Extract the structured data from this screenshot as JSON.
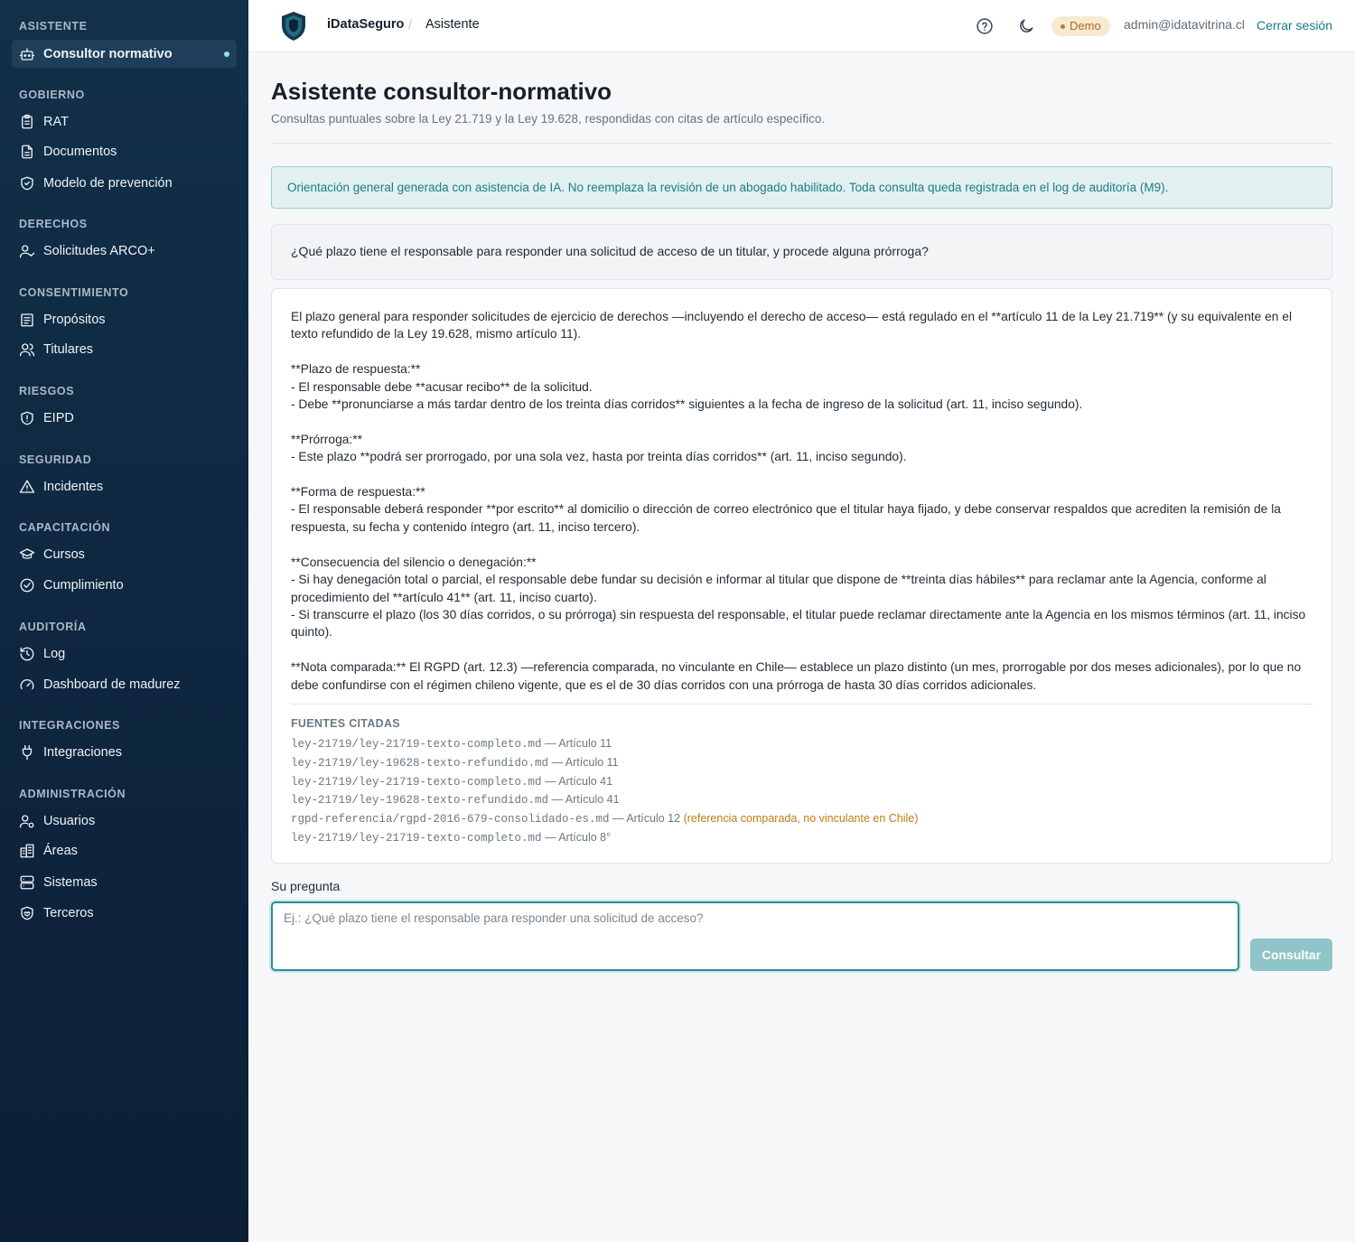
{
  "sidebar": {
    "sections": [
      {
        "title": "ASISTENTE",
        "items": [
          {
            "label": "Consultor normativo",
            "icon": "robot-icon",
            "active": true
          }
        ]
      },
      {
        "title": "GOBIERNO",
        "items": [
          {
            "label": "RAT",
            "icon": "clipboard-icon"
          },
          {
            "label": "Documentos",
            "icon": "document-icon"
          },
          {
            "label": "Modelo de prevención",
            "icon": "shield-check-icon"
          }
        ]
      },
      {
        "title": "DERECHOS",
        "items": [
          {
            "label": "Solicitudes ARCO+",
            "icon": "user-check-icon"
          }
        ]
      },
      {
        "title": "CONSENTIMIENTO",
        "items": [
          {
            "label": "Propósitos",
            "icon": "list-icon"
          },
          {
            "label": "Titulares",
            "icon": "users-icon"
          }
        ]
      },
      {
        "title": "RIESGOS",
        "items": [
          {
            "label": "EIPD",
            "icon": "shield-alert-icon"
          }
        ]
      },
      {
        "title": "SEGURIDAD",
        "items": [
          {
            "label": "Incidentes",
            "icon": "warning-icon"
          }
        ]
      },
      {
        "title": "CAPACITACIÓN",
        "items": [
          {
            "label": "Cursos",
            "icon": "graduation-cap-icon"
          },
          {
            "label": "Cumplimiento",
            "icon": "check-circle-icon"
          }
        ]
      },
      {
        "title": "AUDITORÍA",
        "items": [
          {
            "label": "Log",
            "icon": "history-icon"
          },
          {
            "label": "Dashboard de madurez",
            "icon": "gauge-icon"
          }
        ]
      },
      {
        "title": "INTEGRACIONES",
        "items": [
          {
            "label": "Integraciones",
            "icon": "plug-icon"
          }
        ]
      },
      {
        "title": "ADMINISTRACIÓN",
        "items": [
          {
            "label": "Usuarios",
            "icon": "user-gear-icon"
          },
          {
            "label": "Áreas",
            "icon": "building-icon"
          },
          {
            "label": "Sistemas",
            "icon": "server-icon"
          },
          {
            "label": "Terceros",
            "icon": "handshake-icon"
          }
        ]
      }
    ]
  },
  "header": {
    "brand": "iDataSeguro",
    "separator": "/",
    "breadcrumb": "Asistente",
    "badge": "Demo",
    "user_email": "admin@idatavitrina.cl",
    "logout": "Cerrar sesión"
  },
  "main": {
    "title": "Asistente consultor-normativo",
    "subtitle": "Consultas puntuales sobre la Ley 21.719 y la Ley 19.628, respondidas con citas de artículo específico.",
    "notice": "Orientación general generada con asistencia de IA. No reemplaza la revisión de un abogado habilitado. Toda consulta queda registrada en el log de auditoría (M9).",
    "question": "¿Qué plazo tiene el responsable para responder una solicitud de acceso de un titular, y procede alguna prórroga?",
    "answer": "El plazo general para responder solicitudes de ejercicio de derechos —incluyendo el derecho de acceso— está regulado en el **artículo 11 de la Ley 21.719** (y su equivalente en el texto refundido de la Ley 19.628, mismo artículo 11).\n\n**Plazo de respuesta:**\n- El responsable debe **acusar recibo** de la solicitud.\n- Debe **pronunciarse a más tardar dentro de los treinta días corridos** siguientes a la fecha de ingreso de la solicitud (art. 11, inciso segundo).\n\n**Prórroga:**\n- Este plazo **podrá ser prorrogado, por una sola vez, hasta por treinta días corridos** (art. 11, inciso segundo).\n\n**Forma de respuesta:**\n- El responsable deberá responder **por escrito** al domicilio o dirección de correo electrónico que el titular haya fijado, y debe conservar respaldos que acrediten la remisión de la respuesta, su fecha y contenido íntegro (art. 11, inciso tercero).\n\n**Consecuencia del silencio o denegación:**\n- Si hay denegación total o parcial, el responsable debe fundar su decisión e informar al titular que dispone de **treinta días hábiles** para reclamar ante la Agencia, conforme al procedimiento del **artículo 41** (art. 11, inciso cuarto).\n- Si transcurre el plazo (los 30 días corridos, o su prórroga) sin respuesta del responsable, el titular puede reclamar directamente ante la Agencia en los mismos términos (art. 11, inciso quinto).\n\n**Nota comparada:** El RGPD (art. 12.3) —referencia comparada, no vinculante en Chile— establece un plazo distinto (un mes, prorrogable por dos meses adicionales), por lo que no debe confundirse con el régimen chileno vigente, que es el de 30 días corridos con una prórroga de hasta 30 días corridos adicionales.",
    "sources_title": "FUENTES CITADAS",
    "sources": [
      {
        "file": "ley-21719/ley-21719-texto-completo.md",
        "ref": " — Artículo 11",
        "note": ""
      },
      {
        "file": "ley-21719/ley-19628-texto-refundido.md",
        "ref": " — Artículo 11",
        "note": ""
      },
      {
        "file": "ley-21719/ley-21719-texto-completo.md",
        "ref": " — Artículo 41",
        "note": ""
      },
      {
        "file": "ley-21719/ley-19628-texto-refundido.md",
        "ref": " — Artículo 41",
        "note": ""
      },
      {
        "file": "rgpd-referencia/rgpd-2016-679-consolidado-es.md",
        "ref": " — Artículo 12",
        "note": "(referencia comparada, no vinculante en Chile)"
      },
      {
        "file": "ley-21719/ley-21719-texto-completo.md",
        "ref": " — Artículo 8°",
        "note": ""
      }
    ],
    "input_label": "Su pregunta",
    "input_placeholder": "Ej.: ¿Qué plazo tiene el responsable para responder una solicitud de acceso?",
    "input_value": "",
    "submit_label": "Consultar"
  },
  "colors": {
    "sidebar_bg": "#0f2740",
    "accent": "#157b86",
    "notice_bg": "#e2f0f1",
    "badge_bg": "#f7ead5",
    "badge_text": "#b06a13",
    "button_bg": "#8fc5c9"
  }
}
